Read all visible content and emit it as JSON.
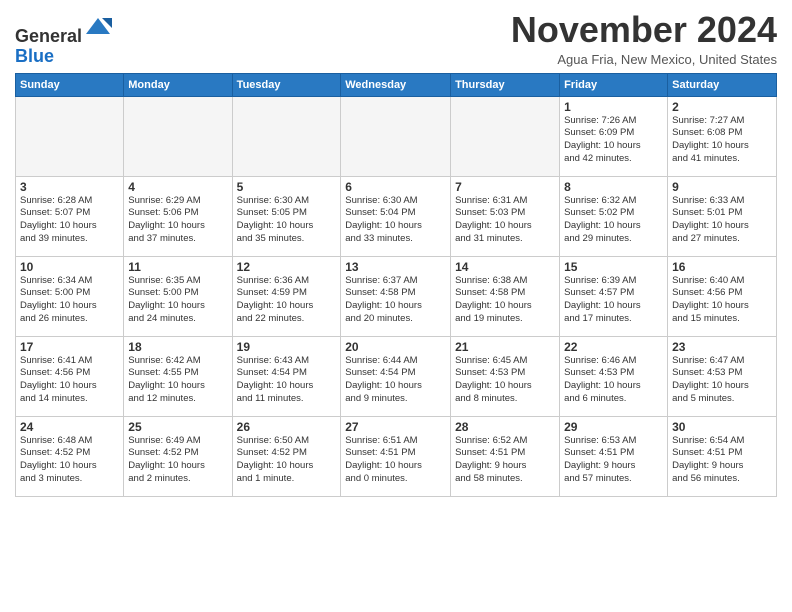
{
  "header": {
    "logo": {
      "line1": "General",
      "line2": "Blue"
    },
    "title": "November 2024",
    "subtitle": "Agua Fria, New Mexico, United States"
  },
  "calendar": {
    "headers": [
      "Sunday",
      "Monday",
      "Tuesday",
      "Wednesday",
      "Thursday",
      "Friday",
      "Saturday"
    ],
    "weeks": [
      [
        {
          "day": "",
          "info": ""
        },
        {
          "day": "",
          "info": ""
        },
        {
          "day": "",
          "info": ""
        },
        {
          "day": "",
          "info": ""
        },
        {
          "day": "",
          "info": ""
        },
        {
          "day": "1",
          "info": "Sunrise: 7:26 AM\nSunset: 6:09 PM\nDaylight: 10 hours\nand 42 minutes."
        },
        {
          "day": "2",
          "info": "Sunrise: 7:27 AM\nSunset: 6:08 PM\nDaylight: 10 hours\nand 41 minutes."
        }
      ],
      [
        {
          "day": "3",
          "info": "Sunrise: 6:28 AM\nSunset: 5:07 PM\nDaylight: 10 hours\nand 39 minutes."
        },
        {
          "day": "4",
          "info": "Sunrise: 6:29 AM\nSunset: 5:06 PM\nDaylight: 10 hours\nand 37 minutes."
        },
        {
          "day": "5",
          "info": "Sunrise: 6:30 AM\nSunset: 5:05 PM\nDaylight: 10 hours\nand 35 minutes."
        },
        {
          "day": "6",
          "info": "Sunrise: 6:30 AM\nSunset: 5:04 PM\nDaylight: 10 hours\nand 33 minutes."
        },
        {
          "day": "7",
          "info": "Sunrise: 6:31 AM\nSunset: 5:03 PM\nDaylight: 10 hours\nand 31 minutes."
        },
        {
          "day": "8",
          "info": "Sunrise: 6:32 AM\nSunset: 5:02 PM\nDaylight: 10 hours\nand 29 minutes."
        },
        {
          "day": "9",
          "info": "Sunrise: 6:33 AM\nSunset: 5:01 PM\nDaylight: 10 hours\nand 27 minutes."
        }
      ],
      [
        {
          "day": "10",
          "info": "Sunrise: 6:34 AM\nSunset: 5:00 PM\nDaylight: 10 hours\nand 26 minutes."
        },
        {
          "day": "11",
          "info": "Sunrise: 6:35 AM\nSunset: 5:00 PM\nDaylight: 10 hours\nand 24 minutes."
        },
        {
          "day": "12",
          "info": "Sunrise: 6:36 AM\nSunset: 4:59 PM\nDaylight: 10 hours\nand 22 minutes."
        },
        {
          "day": "13",
          "info": "Sunrise: 6:37 AM\nSunset: 4:58 PM\nDaylight: 10 hours\nand 20 minutes."
        },
        {
          "day": "14",
          "info": "Sunrise: 6:38 AM\nSunset: 4:58 PM\nDaylight: 10 hours\nand 19 minutes."
        },
        {
          "day": "15",
          "info": "Sunrise: 6:39 AM\nSunset: 4:57 PM\nDaylight: 10 hours\nand 17 minutes."
        },
        {
          "day": "16",
          "info": "Sunrise: 6:40 AM\nSunset: 4:56 PM\nDaylight: 10 hours\nand 15 minutes."
        }
      ],
      [
        {
          "day": "17",
          "info": "Sunrise: 6:41 AM\nSunset: 4:56 PM\nDaylight: 10 hours\nand 14 minutes."
        },
        {
          "day": "18",
          "info": "Sunrise: 6:42 AM\nSunset: 4:55 PM\nDaylight: 10 hours\nand 12 minutes."
        },
        {
          "day": "19",
          "info": "Sunrise: 6:43 AM\nSunset: 4:54 PM\nDaylight: 10 hours\nand 11 minutes."
        },
        {
          "day": "20",
          "info": "Sunrise: 6:44 AM\nSunset: 4:54 PM\nDaylight: 10 hours\nand 9 minutes."
        },
        {
          "day": "21",
          "info": "Sunrise: 6:45 AM\nSunset: 4:53 PM\nDaylight: 10 hours\nand 8 minutes."
        },
        {
          "day": "22",
          "info": "Sunrise: 6:46 AM\nSunset: 4:53 PM\nDaylight: 10 hours\nand 6 minutes."
        },
        {
          "day": "23",
          "info": "Sunrise: 6:47 AM\nSunset: 4:53 PM\nDaylight: 10 hours\nand 5 minutes."
        }
      ],
      [
        {
          "day": "24",
          "info": "Sunrise: 6:48 AM\nSunset: 4:52 PM\nDaylight: 10 hours\nand 3 minutes."
        },
        {
          "day": "25",
          "info": "Sunrise: 6:49 AM\nSunset: 4:52 PM\nDaylight: 10 hours\nand 2 minutes."
        },
        {
          "day": "26",
          "info": "Sunrise: 6:50 AM\nSunset: 4:52 PM\nDaylight: 10 hours\nand 1 minute."
        },
        {
          "day": "27",
          "info": "Sunrise: 6:51 AM\nSunset: 4:51 PM\nDaylight: 10 hours\nand 0 minutes."
        },
        {
          "day": "28",
          "info": "Sunrise: 6:52 AM\nSunset: 4:51 PM\nDaylight: 9 hours\nand 58 minutes."
        },
        {
          "day": "29",
          "info": "Sunrise: 6:53 AM\nSunset: 4:51 PM\nDaylight: 9 hours\nand 57 minutes."
        },
        {
          "day": "30",
          "info": "Sunrise: 6:54 AM\nSunset: 4:51 PM\nDaylight: 9 hours\nand 56 minutes."
        }
      ]
    ]
  }
}
